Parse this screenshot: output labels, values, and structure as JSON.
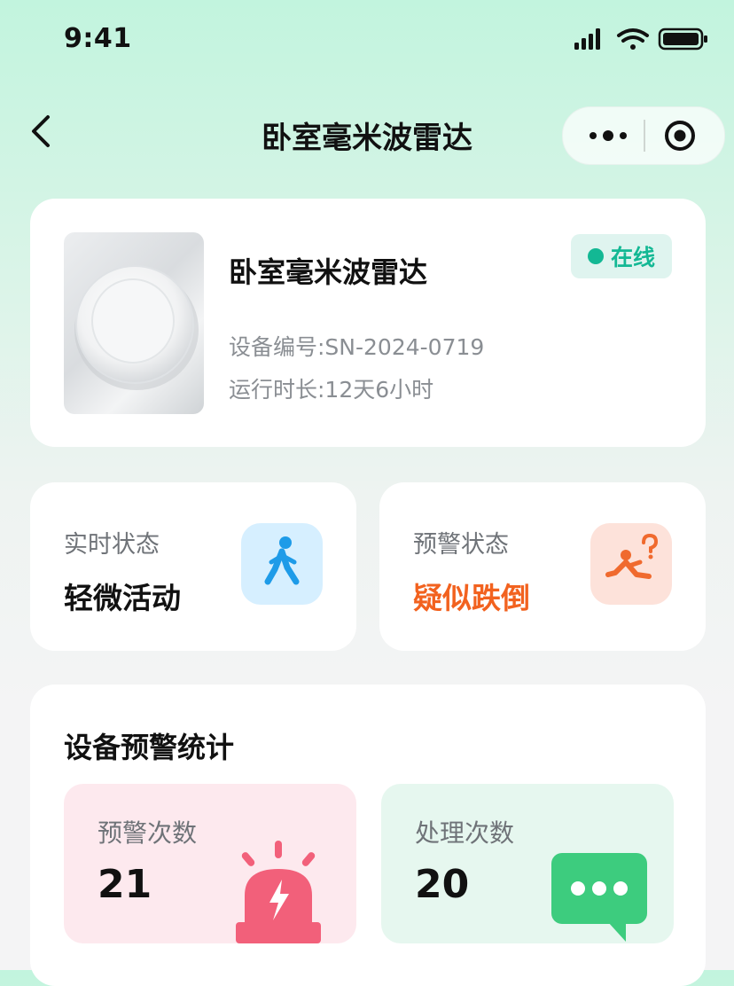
{
  "status_bar": {
    "time": "9:41"
  },
  "nav": {
    "title": "卧室毫米波雷达"
  },
  "device": {
    "name": "卧室毫米波雷达",
    "status": "在线",
    "serial": "设备编号:SN-2024-0719",
    "runtime": "运行时长:12天6小时"
  },
  "realtime": {
    "label": "实时状态",
    "value": "轻微活动",
    "icon": "walking-person-icon"
  },
  "alert": {
    "label": "预警状态",
    "value": "疑似跌倒",
    "icon": "fall-person-icon"
  },
  "stats": {
    "title": "设备预警统计",
    "alert_count_label": "预警次数",
    "alert_count": "21",
    "handled_count_label": "处理次数",
    "handled_count": "20"
  },
  "colors": {
    "online": "#13b894",
    "warning": "#f2621f",
    "siren": "#f2607a",
    "chat": "#3dcc7e"
  }
}
